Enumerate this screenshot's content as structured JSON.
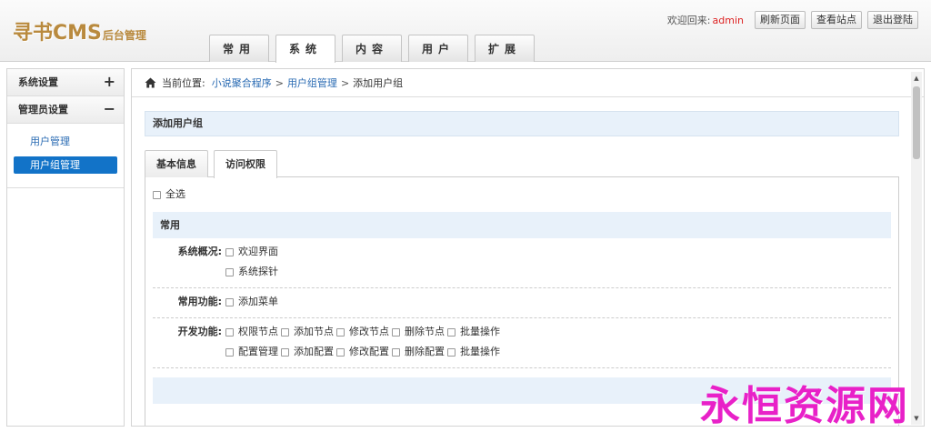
{
  "logo": {
    "main": "寻书CMS",
    "sub": "后台管理"
  },
  "topbar": {
    "welcome": "欢迎回来:",
    "username": "admin",
    "buttons": [
      "刷新页面",
      "查看站点",
      "退出登陆"
    ]
  },
  "nav": {
    "tabs": [
      "常用",
      "系统",
      "内容",
      "用户",
      "扩展"
    ],
    "active": 1
  },
  "sidebar": {
    "sections": [
      {
        "label": "系统设置",
        "toggle": "+"
      },
      {
        "label": "管理员设置",
        "toggle": "−"
      }
    ],
    "items": [
      "用户管理",
      "用户组管理"
    ]
  },
  "breadcrumb": {
    "prefix": "当前位置:",
    "links": [
      "小说聚合程序",
      "用户组管理"
    ],
    "current": "添加用户组",
    "sep": ">"
  },
  "page": {
    "title": "添加用户组"
  },
  "tabs": [
    "基本信息",
    "访问权限"
  ],
  "permissions": {
    "select_all": "全选",
    "section": "常用",
    "groups": [
      {
        "label": "系统概况:",
        "rows": [
          [
            "欢迎界面"
          ],
          [
            "系统探针"
          ]
        ]
      },
      {
        "label": "常用功能:",
        "rows": [
          [
            "添加菜单"
          ]
        ]
      },
      {
        "label": "开发功能:",
        "rows": [
          [
            "权限节点",
            "添加节点",
            "修改节点",
            "删除节点",
            "批量操作"
          ],
          [
            "配置管理",
            "添加配置",
            "修改配置",
            "删除配置",
            "批量操作"
          ]
        ]
      }
    ]
  },
  "watermark": "永恒资源网",
  "colors": {
    "accent": "#1273c8",
    "link": "#2a6bb3",
    "username": "#dd2222",
    "watermark": "#e821c8",
    "section_bg": "#e8f1fa"
  }
}
